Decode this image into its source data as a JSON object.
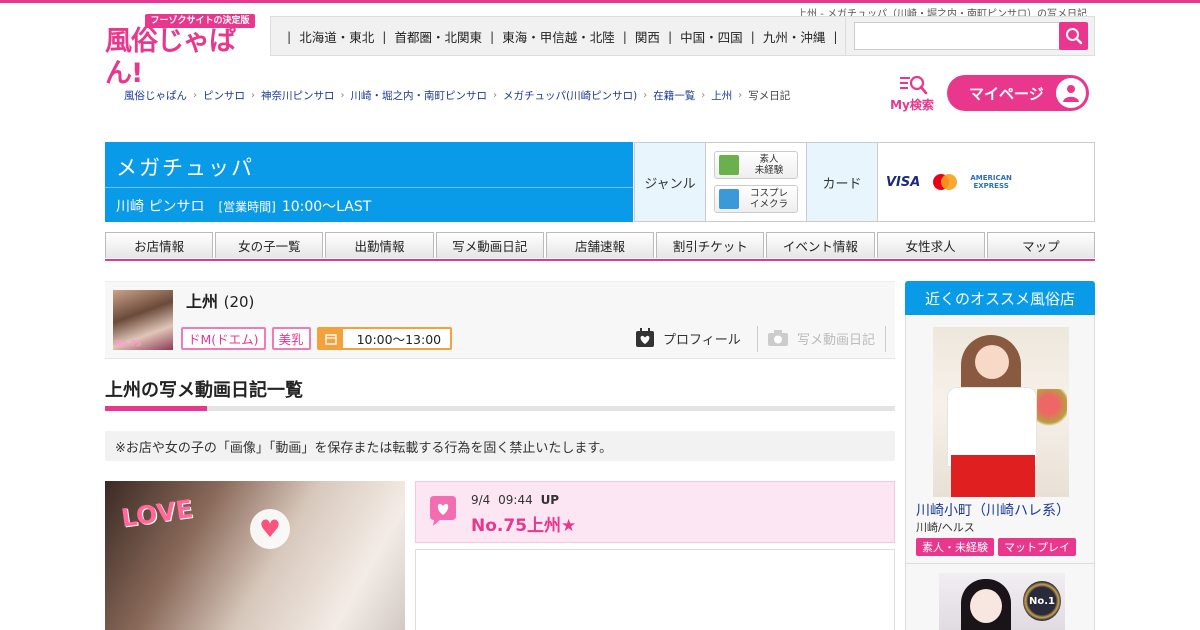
{
  "page_caption": "上州 - メガチュッパ（川崎・堀之内・南町ピンサロ）の写メ日記",
  "logo": {
    "tagline": "フーゾクサイトの決定版",
    "name": "風俗じゃぱん!"
  },
  "regions": [
    "北海道・東北",
    "首都圏・北関東",
    "東海・甲信越・北陸",
    "関西",
    "中国・四国",
    "九州・沖縄"
  ],
  "region_sep": "|",
  "search": {
    "placeholder": ""
  },
  "breadcrumb": [
    "風俗じゃぱん",
    "ピンサロ",
    "神奈川ピンサロ",
    "川崎・堀之内・南町ピンサロ",
    "メガチュッパ(川崎ピンサロ)",
    "在籍一覧",
    "上州"
  ],
  "breadcrumb_current": "写メ日記",
  "my_search_label": "My検索",
  "my_page_label": "マイページ",
  "shop": {
    "name": "メガチュッパ",
    "area": "川崎 ピンサロ",
    "hours_label": "[営業時間]",
    "hours": "10:00～LAST"
  },
  "info": {
    "genre_label": "ジャンル",
    "genres": [
      {
        "label": "素人\n未経験",
        "color": "#6ab04c"
      },
      {
        "label": "コスプレ\nイメクラ",
        "color": "#3a9ad8"
      }
    ],
    "card_label": "カード",
    "cards": {
      "visa": "VISA",
      "amex": "AMERICAN\nEXPRESS"
    }
  },
  "tabs": [
    "お店情報",
    "女の子一覧",
    "出勤情報",
    "写メ動画日記",
    "店舗速報",
    "割引チケット",
    "イベント情報",
    "女性求人",
    "マップ"
  ],
  "girl": {
    "name": "上州",
    "age": "(20)",
    "thumb_label": "No.75",
    "tags": [
      "ドM(ドエム)",
      "美乳"
    ],
    "time": "10:00～13:00",
    "profile_label": "プロフィール",
    "diary_label": "写メ動画日記"
  },
  "section_title": "上州の写メ動画日記一覧",
  "notice": "※お店や女の子の「画像」「動画」を保存または転載する行為を固く禁止いたします。",
  "post": {
    "photo_text": "LOVE",
    "date": "9/4",
    "time": "09:44",
    "up_label": "UP",
    "title": "No.75上州★"
  },
  "sidebar": {
    "title": "近くのオススメ風俗店",
    "shop_name": "川崎小町（川崎ハレ系）",
    "shop_sub": "川崎/ヘルス",
    "tags": [
      "素人・未経験",
      "マットプレイ"
    ],
    "medal_text": "No.1"
  },
  "colors": {
    "brand_pink": "#e8378c",
    "brand_blue": "#0a9be8"
  }
}
